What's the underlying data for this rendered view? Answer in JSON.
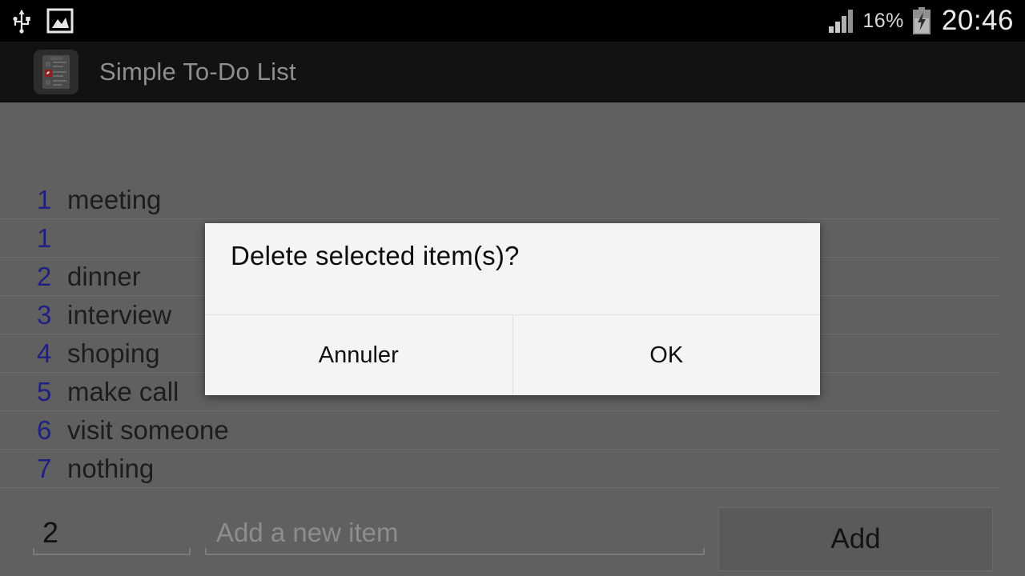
{
  "status_bar": {
    "icons": [
      "usb-icon",
      "screenshot-image-icon",
      "signal-icon",
      "battery-charging-icon"
    ],
    "battery_percent": "16%",
    "clock": "20:46"
  },
  "app_bar": {
    "icon": "todo-list-app-icon",
    "title": "Simple To-Do List"
  },
  "list": {
    "rows": [
      {
        "num": "1",
        "text": "meeting"
      },
      {
        "num": "1",
        "text": ""
      },
      {
        "num": "2",
        "text": "dinner"
      },
      {
        "num": "3",
        "text": "interview"
      },
      {
        "num": "4",
        "text": "shoping"
      },
      {
        "num": "5",
        "text": "make call"
      },
      {
        "num": "6",
        "text": "visit someone"
      },
      {
        "num": "7",
        "text": "nothing"
      }
    ]
  },
  "bottom_bar": {
    "quantity_value": "2",
    "quantity_placeholder": "",
    "new_item_value": "",
    "new_item_placeholder": "Add a new item",
    "add_label": "Add"
  },
  "dialog": {
    "title": "Delete selected item(s)?",
    "cancel_label": "Annuler",
    "ok_label": "OK"
  },
  "colors": {
    "status_bar_bg": "#000000",
    "app_bar_bg": "#121212",
    "app_title": "#8e8e8e",
    "content_dim_bg": "#606060",
    "row_number": "#1f2080",
    "row_text": "#1d1d1d",
    "dialog_bg": "#f4f4f4",
    "add_button_bg": "#5a5a5a"
  }
}
